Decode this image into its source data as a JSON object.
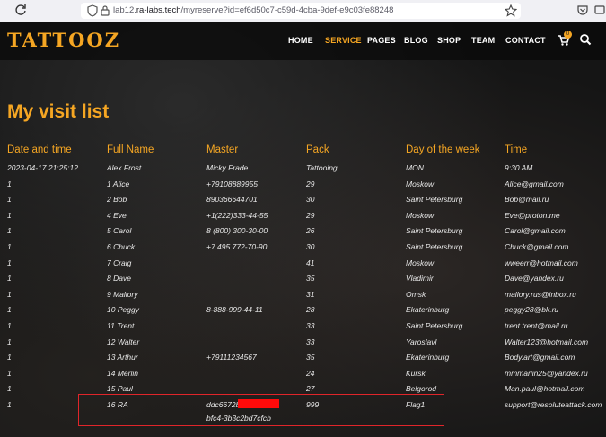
{
  "browser": {
    "url_prefix": "lab12.",
    "url_domain": "ra-labs.tech",
    "url_path": "/myreserve?id=ef6d50c7-c59d-4cba-9def-e9c03fe88248"
  },
  "nav": {
    "logo": "TATTOOZ",
    "items": [
      "HOME",
      "SERVICE",
      "PAGES",
      "BLOG",
      "SHOP",
      "TEAM",
      "CONTACT"
    ],
    "active": "SERVICE",
    "cart_count": "0"
  },
  "page_title": "My visit list",
  "table": {
    "headers": [
      "Date and time",
      "Full Name",
      "Master",
      "Pack",
      "Day of the week",
      "Time"
    ],
    "rows": [
      [
        "2023-04-17 21:25:12",
        "Alex Frost",
        "Micky Frade",
        "Tattooing",
        "MON",
        "9:30 AM"
      ],
      [
        "1",
        "1 Alice",
        "+79108889955",
        "29",
        "Moskow",
        "Alice@gmail.com"
      ],
      [
        "1",
        "2 Bob",
        "890366644701",
        "30",
        "Saint Petersburg",
        "Bob@mail.ru"
      ],
      [
        "1",
        "4 Eve",
        "+1(222)333-44-55",
        "29",
        "Moskow",
        "Eve@proton.me"
      ],
      [
        "1",
        "5 Carol",
        "8 (800) 300-30-00",
        "26",
        "Saint Petersburg",
        "Carol@gmail.com"
      ],
      [
        "1",
        "6 Chuck",
        "+7 495 772-70-90",
        "30",
        "Saint Petersburg",
        "Chuck@gmail.com"
      ],
      [
        "1",
        "7 Craig",
        "",
        "41",
        "Moskow",
        "wweerr@hotmail.com"
      ],
      [
        "1",
        "8 Dave",
        "",
        "35",
        "Vladimir",
        "Dave@yandex.ru"
      ],
      [
        "1",
        "9 Mallory",
        "",
        "31",
        "Omsk",
        "mallory.rus@inbox.ru"
      ],
      [
        "1",
        "10 Peggy",
        "8-888-999-44-11",
        "28",
        "Ekaterinburg",
        "peggy28@bk.ru"
      ],
      [
        "1",
        "11 Trent",
        "",
        "33",
        "Saint Petersburg",
        "trent.trent@mail.ru"
      ],
      [
        "1",
        "12 Walter",
        "",
        "33",
        "Yaroslavl",
        "Walter123@hotmail.com"
      ],
      [
        "1",
        "13 Arthur",
        "+79111234567",
        "35",
        "Ekaterinburg",
        "Body.art@gmail.com"
      ],
      [
        "1",
        "14 Merlin",
        "",
        "24",
        "Kursk",
        "mmmarlin25@yandex.ru"
      ],
      [
        "1",
        "15 Paul",
        "",
        "27",
        "Belgorod",
        "Man.paul@hotmail.com"
      ],
      [
        "1",
        "16 RA",
        "ddc6672b",
        "999",
        "Flag1",
        "support@resoluteattack.com"
      ]
    ],
    "last_row_master_line2": "bfc4-3b3c2bd7cfcb"
  }
}
